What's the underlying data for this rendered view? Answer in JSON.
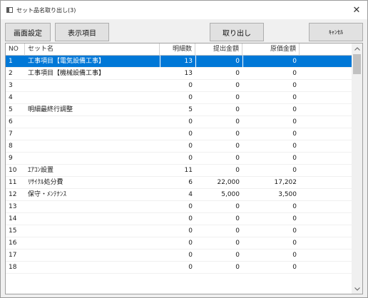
{
  "window": {
    "title": "セット品名取り出し(3)"
  },
  "toolbar": {
    "screen_settings": "画面設定",
    "display_items": "表示項目",
    "extract": "取り出し",
    "cancel": "ｷｬﾝｾﾙ"
  },
  "grid": {
    "columns": [
      "NO",
      "セット名",
      "明細数",
      "提出金額",
      "原価金額"
    ],
    "rows": [
      {
        "no": "1",
        "name": "工事項目【電気設備工事】",
        "count": "13",
        "submit": "0",
        "cost": "0",
        "selected": true
      },
      {
        "no": "2",
        "name": "工事項目【機械設備工事】",
        "count": "13",
        "submit": "0",
        "cost": "0"
      },
      {
        "no": "3",
        "name": "",
        "count": "0",
        "submit": "0",
        "cost": "0"
      },
      {
        "no": "4",
        "name": "",
        "count": "0",
        "submit": "0",
        "cost": "0"
      },
      {
        "no": "5",
        "name": "明細最終行調整",
        "count": "5",
        "submit": "0",
        "cost": "0"
      },
      {
        "no": "6",
        "name": "",
        "count": "0",
        "submit": "0",
        "cost": "0"
      },
      {
        "no": "7",
        "name": "",
        "count": "0",
        "submit": "0",
        "cost": "0"
      },
      {
        "no": "8",
        "name": "",
        "count": "0",
        "submit": "0",
        "cost": "0"
      },
      {
        "no": "9",
        "name": "",
        "count": "0",
        "submit": "0",
        "cost": "0"
      },
      {
        "no": "10",
        "name": "ｴｱｺﾝ設置",
        "count": "11",
        "submit": "0",
        "cost": "0"
      },
      {
        "no": "11",
        "name": "ﾘｻｲｸﾙ処分費",
        "count": "6",
        "submit": "22,000",
        "cost": "17,202"
      },
      {
        "no": "12",
        "name": "保守・ﾒﾝﾃﾅﾝｽ",
        "count": "4",
        "submit": "5,000",
        "cost": "3,500"
      },
      {
        "no": "13",
        "name": "",
        "count": "0",
        "submit": "0",
        "cost": "0"
      },
      {
        "no": "14",
        "name": "",
        "count": "0",
        "submit": "0",
        "cost": "0"
      },
      {
        "no": "15",
        "name": "",
        "count": "0",
        "submit": "0",
        "cost": "0"
      },
      {
        "no": "16",
        "name": "",
        "count": "0",
        "submit": "0",
        "cost": "0"
      },
      {
        "no": "17",
        "name": "",
        "count": "0",
        "submit": "0",
        "cost": "0"
      },
      {
        "no": "18",
        "name": "",
        "count": "0",
        "submit": "0",
        "cost": "0"
      }
    ]
  },
  "icons": {
    "window": "window-icon",
    "close": "close-icon",
    "scroll_up": "chevron-up-icon",
    "scroll_down": "chevron-down-icon"
  },
  "colors": {
    "selection": "#0078d7",
    "button_bg": "#e1e1e1",
    "window_bg": "#f0f0f0"
  }
}
